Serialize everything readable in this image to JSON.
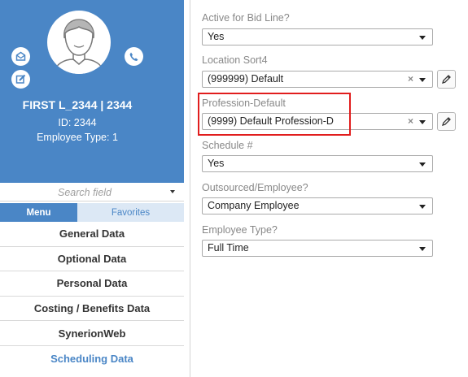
{
  "profile": {
    "name": "FIRST L_2344 | 2344",
    "id_line": "ID: 2344",
    "type_line": "Employee Type: 1"
  },
  "search": {
    "placeholder": "Search field"
  },
  "tabs": {
    "menu": "Menu",
    "favorites": "Favorites"
  },
  "menu": {
    "items": [
      "General Data",
      "Optional Data",
      "Personal Data",
      "Costing / Benefits Data",
      "SynerionWeb",
      "Scheduling Data"
    ],
    "active_item": "Scheduling Data"
  },
  "form": {
    "active_bid": {
      "label": "Active for Bid Line?",
      "value": "Yes"
    },
    "location_sort": {
      "label": "Location Sort4",
      "value": "(999999) Default"
    },
    "profession": {
      "label": "Profession-Default",
      "value": "(9999) Default Profession-D"
    },
    "schedule": {
      "label": "Schedule #",
      "value": "Yes"
    },
    "outsourced": {
      "label": "Outsourced/Employee?",
      "value": "Company Employee"
    },
    "employee_type": {
      "label": "Employee Type?",
      "value": "Full Time"
    }
  },
  "icons": {
    "mail": "mail-icon",
    "phone": "phone-icon",
    "edit": "pencil-icon",
    "clear": "clear-x-icon"
  },
  "colors": {
    "brand_blue": "#4a86c6",
    "favorites_tab_bg": "#dce8f5",
    "highlight_red": "#e11d1d"
  }
}
